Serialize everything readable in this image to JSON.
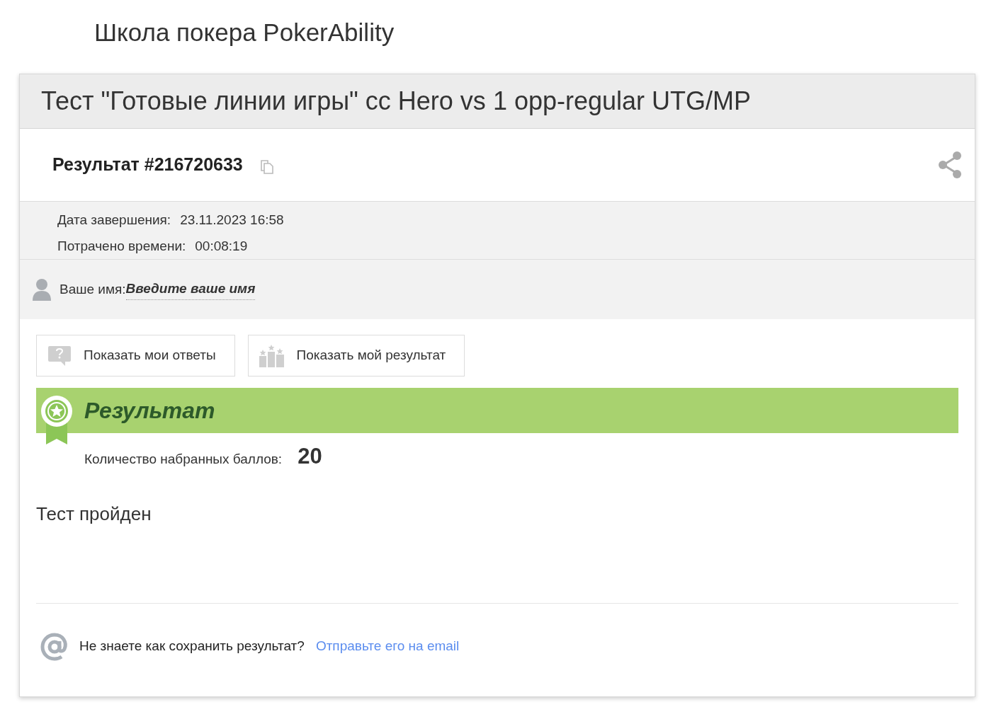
{
  "site_title": "Школа покера PokerAbility",
  "test_title": "Тест \"Готовые линии игры\" cc Hero vs 1 opp-regular UTG/MP",
  "result_heading": "Результат #216720633",
  "details": [
    {
      "label": "Дата завершения:",
      "value": "23.11.2023 16:58"
    },
    {
      "label": "Потрачено времени:",
      "value": "00:08:19"
    }
  ],
  "name": {
    "label": "Ваше имя:",
    "placeholder": "Введите ваше имя"
  },
  "buttons": [
    {
      "kind": "answers",
      "label": "Показать мои ответы"
    },
    {
      "kind": "result",
      "label": "Показать мой результат"
    }
  ],
  "banner": {
    "title": "Результат"
  },
  "score": {
    "label": "Количество набранных баллов:",
    "value": "20"
  },
  "verdict": "Тест пройден",
  "footer": {
    "text": "Не знаете как сохранить результат?",
    "link": "Отправьте его на email"
  }
}
